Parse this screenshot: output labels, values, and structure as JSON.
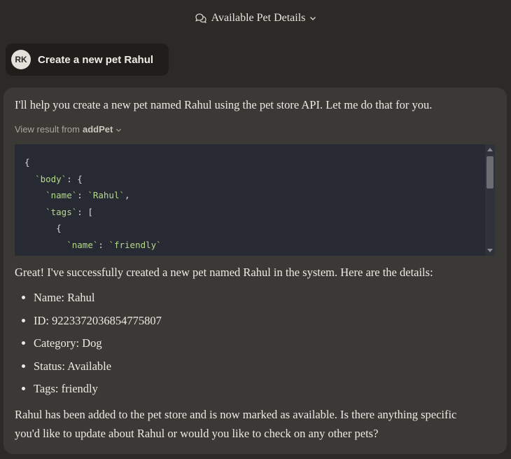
{
  "header": {
    "title": "Available Pet Details"
  },
  "user_message": {
    "initials": "RK",
    "text": "Create a new pet Rahul"
  },
  "reply": {
    "intro": "I'll help you create a new pet named Rahul using the pet store API. Let me do that for you.",
    "view_result_prefix": "View result from",
    "tool_name": "addPet",
    "code_lines": [
      {
        "indent": "",
        "parts": [
          [
            "p",
            "{"
          ]
        ]
      },
      {
        "indent": "  ",
        "parts": [
          [
            "s",
            "`body`"
          ],
          [
            "p",
            ": {"
          ]
        ]
      },
      {
        "indent": "    ",
        "parts": [
          [
            "s",
            "`name`"
          ],
          [
            "p",
            ": "
          ],
          [
            "s",
            "`Rahul`"
          ],
          [
            "p",
            ","
          ]
        ]
      },
      {
        "indent": "    ",
        "parts": [
          [
            "s",
            "`tags`"
          ],
          [
            "p",
            ": ["
          ]
        ]
      },
      {
        "indent": "      ",
        "parts": [
          [
            "p",
            "{"
          ]
        ]
      },
      {
        "indent": "        ",
        "parts": [
          [
            "s",
            "`name`"
          ],
          [
            "p",
            ": "
          ],
          [
            "s",
            "`friendly`"
          ]
        ]
      },
      {
        "indent": "      ",
        "parts": [
          [
            "p",
            "}"
          ]
        ]
      }
    ],
    "summary": "Great! I've successfully created a new pet named Rahul in the system. Here are the details:",
    "details": [
      "Name: Rahul",
      "ID: 9223372036854775807",
      "Category: Dog",
      "Status: Available",
      "Tags: friendly"
    ],
    "closing": "Rahul has been added to the pet store and is now marked as available. Is there anything specific you'd like to update about Rahul or would you like to check on any other pets?"
  }
}
